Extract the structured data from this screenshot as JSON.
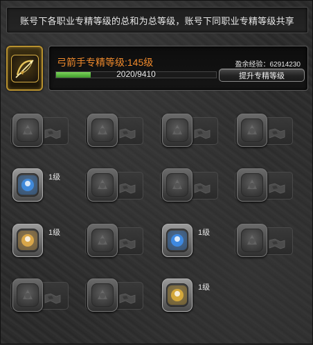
{
  "notice": "账号下各职业专精等级的总和为总等级，账号下同职业专精等级共享",
  "class": {
    "icon": "archer-bow-icon",
    "accent": "#b8912e"
  },
  "mastery": {
    "title": "弓箭手专精等级:145级",
    "progress_text": "2020/9410",
    "progress_current": 2020,
    "progress_max": 9410,
    "xp_remaining": "盈余经验：62914230",
    "upgrade_label": "提升专精等级",
    "title_color": "#f08a2c",
    "bar_color": "#5fb843"
  },
  "skills": [
    {
      "icon": "locked-skill-icon",
      "active": false,
      "level": ""
    },
    {
      "icon": "locked-skill-icon",
      "active": false,
      "level": ""
    },
    {
      "icon": "locked-skill-icon",
      "active": false,
      "level": ""
    },
    {
      "icon": "locked-skill-icon",
      "active": false,
      "level": ""
    },
    {
      "icon": "blue-burst-skill-icon",
      "active": true,
      "level": "1级",
      "color": "#3f8fe8"
    },
    {
      "icon": "locked-skill-icon",
      "active": false,
      "level": ""
    },
    {
      "icon": "locked-skill-icon",
      "active": false,
      "level": ""
    },
    {
      "icon": "locked-skill-icon",
      "active": false,
      "level": ""
    },
    {
      "icon": "golden-flame-skill-icon",
      "active": true,
      "level": "1级",
      "color": "#e7b04a"
    },
    {
      "icon": "locked-skill-icon",
      "active": false,
      "level": ""
    },
    {
      "icon": "blue-figure-skill-icon",
      "active": true,
      "level": "1级",
      "color": "#3d8ff0"
    },
    {
      "icon": "locked-skill-icon",
      "active": false,
      "level": ""
    },
    {
      "icon": "locked-skill-icon",
      "active": false,
      "level": ""
    },
    {
      "icon": "locked-skill-icon",
      "active": false,
      "level": ""
    },
    {
      "icon": "golden-bow-skill-icon",
      "active": true,
      "level": "1级",
      "color": "#e2b23a"
    }
  ]
}
